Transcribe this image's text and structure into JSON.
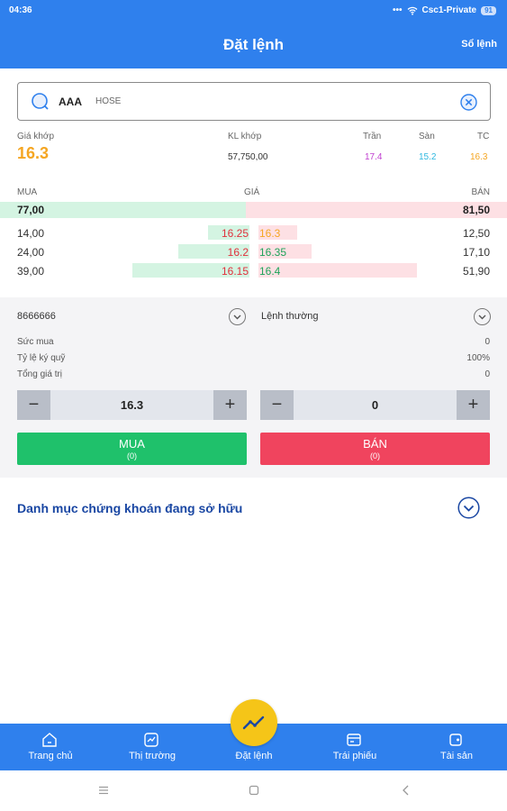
{
  "status_bar": {
    "time": "04:36",
    "dots": "•••",
    "network": "Csc1-Private",
    "battery": "91"
  },
  "header": {
    "title": "Đặt lệnh",
    "right_link": "Sổ lệnh"
  },
  "search": {
    "symbol": "AAA",
    "exchange": "HOSE"
  },
  "quote": {
    "match_price_label": "Giá khớp",
    "match_price": "16.3",
    "match_volume_label": "KL khớp",
    "match_volume": "57,750,00",
    "ceiling_label": "Trần",
    "ceiling": "17.4",
    "floor_label": "Sàn",
    "floor": "15.2",
    "ref_label": "TC",
    "ref": "16.3"
  },
  "orderbook": {
    "buy_label": "MUA",
    "price_label": "GIÁ",
    "sell_label": "BÁN",
    "total_buy": "77,00",
    "total_sell": "81,50",
    "rows": [
      {
        "buy_vol": "14,00",
        "buy_price": "16.25",
        "sell_price": "16.3",
        "sell_vol": "12,50",
        "buy_ratio": 0.18,
        "sell_ratio": 0.17
      },
      {
        "buy_vol": "24,00",
        "buy_price": "16.2",
        "sell_price": "16.35",
        "sell_vol": "17,10",
        "buy_ratio": 0.31,
        "sell_ratio": 0.23
      },
      {
        "buy_vol": "39,00",
        "buy_price": "16.15",
        "sell_price": "16.4",
        "sell_vol": "51,90",
        "buy_ratio": 0.51,
        "sell_ratio": 0.69
      }
    ]
  },
  "form": {
    "account": "8666666",
    "order_type": "Lệnh thường",
    "purchasing_power_label": "Sức mua",
    "purchasing_power": "0",
    "margin_ratio_label": "Tỷ lệ ký quỹ",
    "margin_ratio": "100%",
    "total_value_label": "Tổng giá trị",
    "total_value": "0",
    "price_value": "16.3",
    "quantity_value": "0",
    "minus": "−",
    "plus": "+",
    "buy_button": "MUA",
    "buy_count": "(0)",
    "sell_button": "BÁN",
    "sell_count": "(0)"
  },
  "portfolio": {
    "title": "Danh mục chứng khoán đang sở hữu"
  },
  "bottom_nav": {
    "home": "Trang chủ",
    "market": "Thị trường",
    "order": "Đặt lệnh",
    "bonds": "Trái phiếu",
    "assets": "Tài sản"
  },
  "colors": {
    "primary": "#2f80ed",
    "gold": "#f5a623",
    "ceiling": "#c040d0",
    "floor": "#2fb8e0",
    "buy_green": "#1fc16b",
    "sell_red": "#f0445e",
    "portfolio_blue": "#1a47a3"
  }
}
